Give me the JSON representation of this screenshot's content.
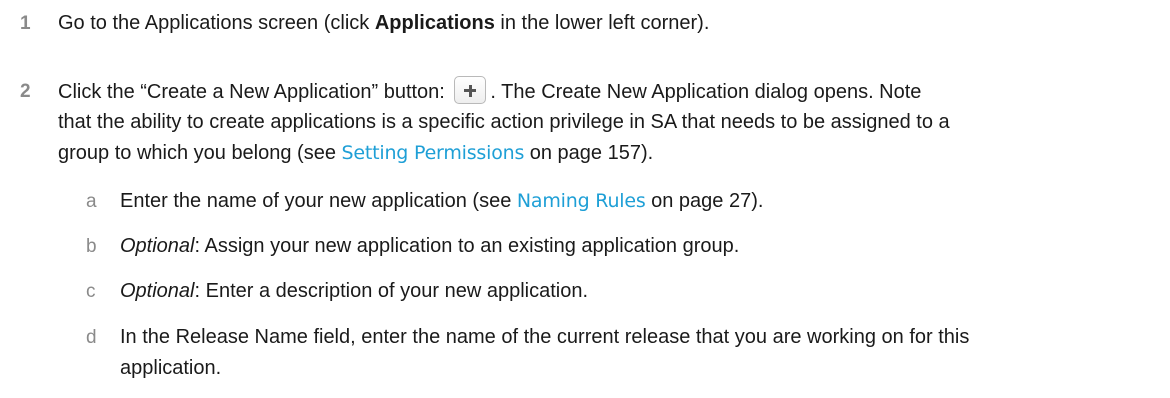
{
  "steps": [
    {
      "number": "1",
      "text_before": "Go to the Applications screen (click ",
      "bold": "Applications",
      "text_after": " in the lower left corner)."
    },
    {
      "number": "2",
      "text_before": "Click the “Create a New Application” button: ",
      "button_icon": "plus-icon",
      "line1_after": ". The Create New Application dialog opens. Note",
      "line2": "that the ability to create applications is a specific action privilege in SA that needs to be assigned to a",
      "line3_before": "group to which you belong (see ",
      "link": "Setting Permissions",
      "line3_after": " on page 157).",
      "substeps": [
        {
          "letter": "a",
          "text_before": "Enter the name of your new application (see ",
          "link": "Naming Rules",
          "text_after": " on page 27)."
        },
        {
          "letter": "b",
          "italic": "Optional",
          "text": ": Assign your new application to an existing application group."
        },
        {
          "letter": "c",
          "italic": "Optional",
          "text": ": Enter a description of your new application."
        },
        {
          "letter": "d",
          "line1": "In the Release Name field, enter the name of the current release that you are working on for this",
          "line2": "application."
        }
      ]
    }
  ],
  "colors": {
    "text": "#1a1a1a",
    "step_number": "#8a8a8a",
    "link": "#1e9fd6"
  }
}
